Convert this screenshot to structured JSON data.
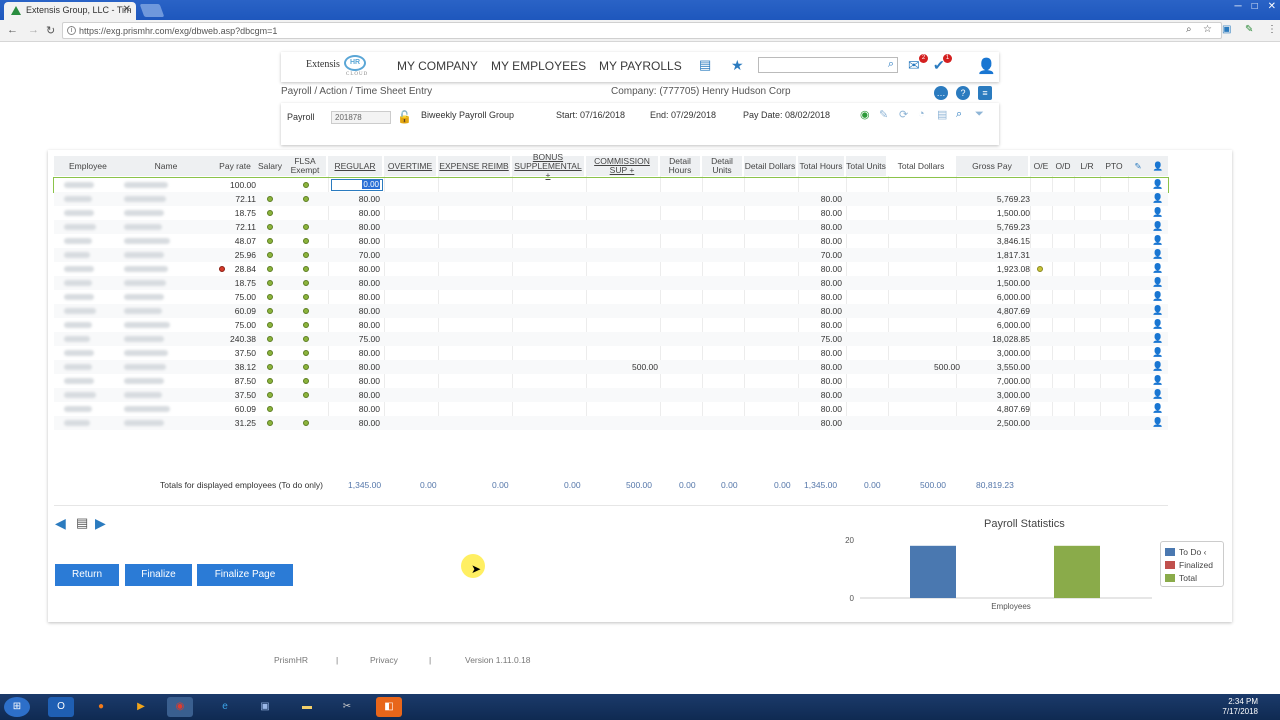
{
  "browser": {
    "tab_title": "Extensis Group, LLC - Tim",
    "url": "https://exg.prismhr.com/exg/dbweb.asp?dbcgm=1"
  },
  "app": {
    "logo_text": "Extensis",
    "logo_badge": "HR",
    "logo_sub": "CLOUD",
    "nav": [
      "MY COMPANY",
      "MY EMPLOYEES",
      "MY PAYROLLS"
    ],
    "mail_badge": "2",
    "alert_badge": "1"
  },
  "page": {
    "breadcrumb": "Payroll / Action / Time Sheet Entry",
    "company": "Company: (777705) Henry Hudson Corp"
  },
  "payroll": {
    "label": "Payroll",
    "number": "201878",
    "group": "Biweekly Payroll Group",
    "start": "Start: 07/16/2018",
    "end": "End: 07/29/2018",
    "pay_date": "Pay Date: 08/02/2018"
  },
  "grid": {
    "headers": {
      "employee": "Employee",
      "name": "Name",
      "pay_rate": "Pay rate",
      "salary": "Salary",
      "flsa": "FLSA Exempt",
      "regular": "REGULAR",
      "overtime": "OVERTIME",
      "expense": "EXPENSE REIMB",
      "bonus": "BONUS SUPPLEMENTAL +",
      "commission": "COMMISSION SUP +",
      "detail_hours": "Detail Hours",
      "detail_units": "Detail Units",
      "detail_dollars": "Detail Dollars",
      "total_hours": "Total Hours",
      "total_units": "Total Units",
      "total_dollars": "Total Dollars",
      "gross_pay": "Gross Pay",
      "oe": "O/E",
      "od": "O/D",
      "lr": "L/R",
      "pto": "PTO"
    },
    "regular_edit_value": "0.00",
    "rows": [
      {
        "rate": "100.00",
        "salary": false,
        "flsa": true,
        "regular": "",
        "commission": "",
        "total_hours": "",
        "total_dollars": "",
        "gross": "",
        "red": false,
        "oe": false
      },
      {
        "rate": "72.11",
        "salary": true,
        "flsa": true,
        "regular": "80.00",
        "commission": "",
        "total_hours": "80.00",
        "total_dollars": "",
        "gross": "5,769.23",
        "red": false,
        "oe": false
      },
      {
        "rate": "18.75",
        "salary": true,
        "flsa": false,
        "regular": "80.00",
        "commission": "",
        "total_hours": "80.00",
        "total_dollars": "",
        "gross": "1,500.00",
        "red": false,
        "oe": false
      },
      {
        "rate": "72.11",
        "salary": true,
        "flsa": true,
        "regular": "80.00",
        "commission": "",
        "total_hours": "80.00",
        "total_dollars": "",
        "gross": "5,769.23",
        "red": false,
        "oe": false
      },
      {
        "rate": "48.07",
        "salary": true,
        "flsa": true,
        "regular": "80.00",
        "commission": "",
        "total_hours": "80.00",
        "total_dollars": "",
        "gross": "3,846.15",
        "red": false,
        "oe": false
      },
      {
        "rate": "25.96",
        "salary": true,
        "flsa": true,
        "regular": "70.00",
        "commission": "",
        "total_hours": "70.00",
        "total_dollars": "",
        "gross": "1,817.31",
        "red": false,
        "oe": false
      },
      {
        "rate": "28.84",
        "salary": true,
        "flsa": true,
        "regular": "80.00",
        "commission": "",
        "total_hours": "80.00",
        "total_dollars": "",
        "gross": "1,923.08",
        "red": true,
        "oe": true
      },
      {
        "rate": "18.75",
        "salary": true,
        "flsa": true,
        "regular": "80.00",
        "commission": "",
        "total_hours": "80.00",
        "total_dollars": "",
        "gross": "1,500.00",
        "red": false,
        "oe": false
      },
      {
        "rate": "75.00",
        "salary": true,
        "flsa": true,
        "regular": "80.00",
        "commission": "",
        "total_hours": "80.00",
        "total_dollars": "",
        "gross": "6,000.00",
        "red": false,
        "oe": false
      },
      {
        "rate": "60.09",
        "salary": true,
        "flsa": true,
        "regular": "80.00",
        "commission": "",
        "total_hours": "80.00",
        "total_dollars": "",
        "gross": "4,807.69",
        "red": false,
        "oe": false
      },
      {
        "rate": "75.00",
        "salary": true,
        "flsa": true,
        "regular": "80.00",
        "commission": "",
        "total_hours": "80.00",
        "total_dollars": "",
        "gross": "6,000.00",
        "red": false,
        "oe": false
      },
      {
        "rate": "240.38",
        "salary": true,
        "flsa": true,
        "regular": "75.00",
        "commission": "",
        "total_hours": "75.00",
        "total_dollars": "",
        "gross": "18,028.85",
        "red": false,
        "oe": false
      },
      {
        "rate": "37.50",
        "salary": true,
        "flsa": true,
        "regular": "80.00",
        "commission": "",
        "total_hours": "80.00",
        "total_dollars": "",
        "gross": "3,000.00",
        "red": false,
        "oe": false
      },
      {
        "rate": "38.12",
        "salary": true,
        "flsa": true,
        "regular": "80.00",
        "commission": "500.00",
        "total_hours": "80.00",
        "total_dollars": "500.00",
        "gross": "3,550.00",
        "red": false,
        "oe": false
      },
      {
        "rate": "87.50",
        "salary": true,
        "flsa": true,
        "regular": "80.00",
        "commission": "",
        "total_hours": "80.00",
        "total_dollars": "",
        "gross": "7,000.00",
        "red": false,
        "oe": false
      },
      {
        "rate": "37.50",
        "salary": true,
        "flsa": true,
        "regular": "80.00",
        "commission": "",
        "total_hours": "80.00",
        "total_dollars": "",
        "gross": "3,000.00",
        "red": false,
        "oe": false
      },
      {
        "rate": "60.09",
        "salary": true,
        "flsa": false,
        "regular": "80.00",
        "commission": "",
        "total_hours": "80.00",
        "total_dollars": "",
        "gross": "4,807.69",
        "red": false,
        "oe": false
      },
      {
        "rate": "31.25",
        "salary": true,
        "flsa": true,
        "regular": "80.00",
        "commission": "",
        "total_hours": "80.00",
        "total_dollars": "",
        "gross": "2,500.00",
        "red": false,
        "oe": false
      }
    ],
    "totals_label": "Totals for displayed employees (To do only)",
    "totals": [
      "1,345.00",
      "0.00",
      "0.00",
      "0.00",
      "500.00",
      "0.00",
      "0.00",
      "0.00",
      "1,345.00",
      "0.00",
      "500.00",
      "80,819.23"
    ]
  },
  "buttons": {
    "return": "Return",
    "finalize": "Finalize",
    "finalize_page": "Finalize Page"
  },
  "chart_data": {
    "type": "bar",
    "title": "Payroll Statistics",
    "categories": [
      "Employees"
    ],
    "series": [
      {
        "name": "To Do",
        "values": [
          18
        ],
        "color": "#4a78b0"
      },
      {
        "name": "Finalized",
        "values": [
          0
        ],
        "color": "#c0504d"
      },
      {
        "name": "Total",
        "values": [
          18
        ],
        "color": "#8aab4a"
      }
    ],
    "y_ticks": [
      "0",
      "20"
    ],
    "ylim": [
      0,
      20
    ],
    "legend_labels": [
      "To Do ‹",
      "Finalized",
      "Total"
    ],
    "legend": "right"
  },
  "footer": {
    "brand": "PrismHR",
    "privacy": "Privacy",
    "version": "Version 1.11.0.18"
  },
  "taskbar": {
    "time": "2:34 PM",
    "date": "7/17/2018"
  }
}
